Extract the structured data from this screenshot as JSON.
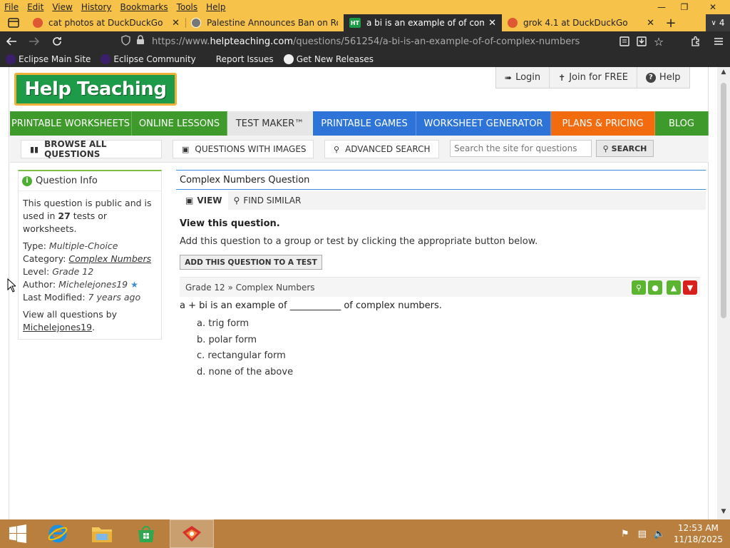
{
  "browser": {
    "menu": [
      "File",
      "Edit",
      "View",
      "History",
      "Bookmarks",
      "Tools",
      "Help"
    ],
    "tabs": [
      {
        "title": "cat photos at DuckDuckGo",
        "active": false
      },
      {
        "title": "Palestine Announces Ban on Ro",
        "active": false
      },
      {
        "title": "a bi is an example of of comple",
        "active": true,
        "favicon_text": "HT"
      },
      {
        "title": "grok 4.1 at DuckDuckGo",
        "active": false
      }
    ],
    "tab_count": "4",
    "url": {
      "scheme": "https://www.",
      "host": "helpteaching.com",
      "path": "/questions/561254/a-bi-is-an-example-of-of-complex-numbers"
    },
    "bookmarks": [
      "Eclipse Main Site",
      "Eclipse Community",
      "Report Issues",
      "Get New Releases"
    ]
  },
  "site": {
    "logo_text": "Help Teaching",
    "account": {
      "login": "Login",
      "join": "Join for FREE",
      "help": "Help"
    },
    "main_nav": [
      {
        "label": "PRINTABLE WORKSHEETS",
        "color": "#3e9a2a"
      },
      {
        "label": "ONLINE LESSONS",
        "color": "#3e9a2a"
      },
      {
        "label": "TEST MAKER™",
        "color": "#e6e6e6"
      },
      {
        "label": "PRINTABLE GAMES",
        "color": "#2e74d8"
      },
      {
        "label": "WORKSHEET GENERATOR",
        "color": "#2e74d8"
      },
      {
        "label": "PLANS & PRICING",
        "color": "#f26b0f"
      },
      {
        "label": "BLOG",
        "color": "#3e9a2a"
      }
    ],
    "sub_nav": {
      "browse": "BROWSE ALL QUESTIONS",
      "images": "QUESTIONS WITH IMAGES",
      "advanced": "ADVANCED SEARCH",
      "search_placeholder": "Search the site for questions",
      "search_button": "SEARCH"
    }
  },
  "sidebar": {
    "title": "Question Info",
    "public_pre": "This question is public and is used in ",
    "public_count": "27",
    "public_post": " tests or worksheets.",
    "type_label": "Type: ",
    "type_value": "Multiple-Choice",
    "category_label": "Category: ",
    "category_value": "Complex Numbers",
    "level_label": "Level: ",
    "level_value": "Grade 12",
    "author_label": "Author: ",
    "author_value": "Michelejones19",
    "modified_label": "Last Modified: ",
    "modified_value": "7 years ago",
    "view_all_pre": "View all questions by",
    "view_all_user": "Michelejones19",
    "view_all_post": "."
  },
  "main": {
    "header": "Complex Numbers Question",
    "tabs": [
      {
        "label": "VIEW"
      },
      {
        "label": "FIND SIMILAR"
      }
    ],
    "view_title": "View this question.",
    "view_desc": "Add this question to a group or test by clicking the appropriate button below.",
    "add_button": "ADD THIS QUESTION TO A TEST",
    "breadcrumb": "Grade 12 » Complex Numbers",
    "question": "a + bi is an example of ___________ of complex numbers.",
    "answers": [
      "a.  trig form",
      "b.  polar form",
      "c.  rectangular form",
      "d.  none of the above"
    ]
  },
  "taskbar": {
    "time": "12:53 AM",
    "date": "11/18/2025"
  }
}
